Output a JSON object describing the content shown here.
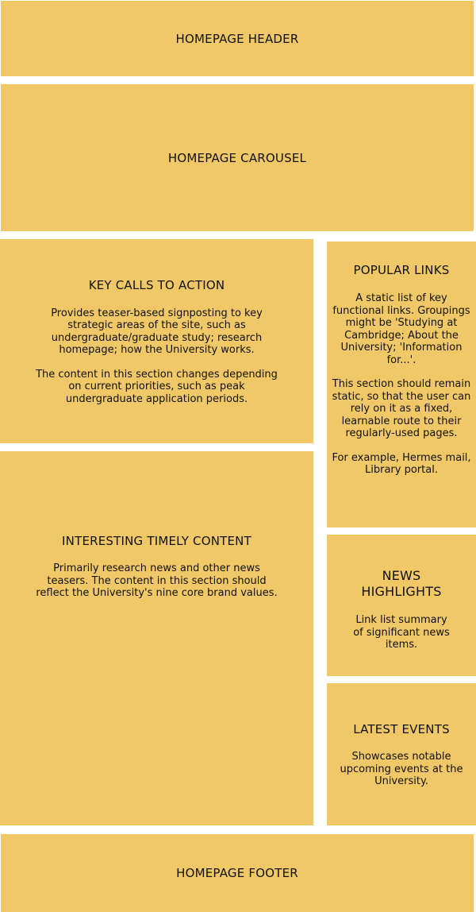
{
  "colors": {
    "block_fill": "#F0C868",
    "background": "#FFFFFF",
    "text": "#111111"
  },
  "header": {
    "title": "HOMEPAGE HEADER"
  },
  "carousel": {
    "title": "HOMEPAGE CAROUSEL"
  },
  "key_calls_to_action": {
    "title": "KEY CALLS TO ACTION",
    "paragraphs": [
      "Provides teaser-based signposting to key strategic areas of the site, such as undergraduate/graduate study; research homepage; how the University works.",
      "The content in this section changes depending on current priorities, such as peak undergraduate application periods."
    ]
  },
  "interesting_timely_content": {
    "title": "INTERESTING TIMELY CONTENT",
    "paragraphs": [
      "Primarily research news and other news teasers. The content in this section should reflect the University's nine core brand values."
    ]
  },
  "popular_links": {
    "title": "POPULAR LINKS",
    "paragraphs": [
      "A static list of key functional links. Groupings might be 'Studying at Cambridge; About the University; 'Information for...'.",
      "This section should remain static, so that the user can rely on it as a fixed, learnable route to their regularly-used pages.",
      "For example, Hermes mail, Library portal."
    ]
  },
  "news_highlights": {
    "title": "NEWS HIGHLIGHTS",
    "paragraphs": [
      "Link list summary of significant news items."
    ]
  },
  "latest_events": {
    "title": "LATEST EVENTS",
    "paragraphs": [
      "Showcases notable upcoming events at the University."
    ]
  },
  "footer": {
    "title": "HOMEPAGE FOOTER"
  }
}
